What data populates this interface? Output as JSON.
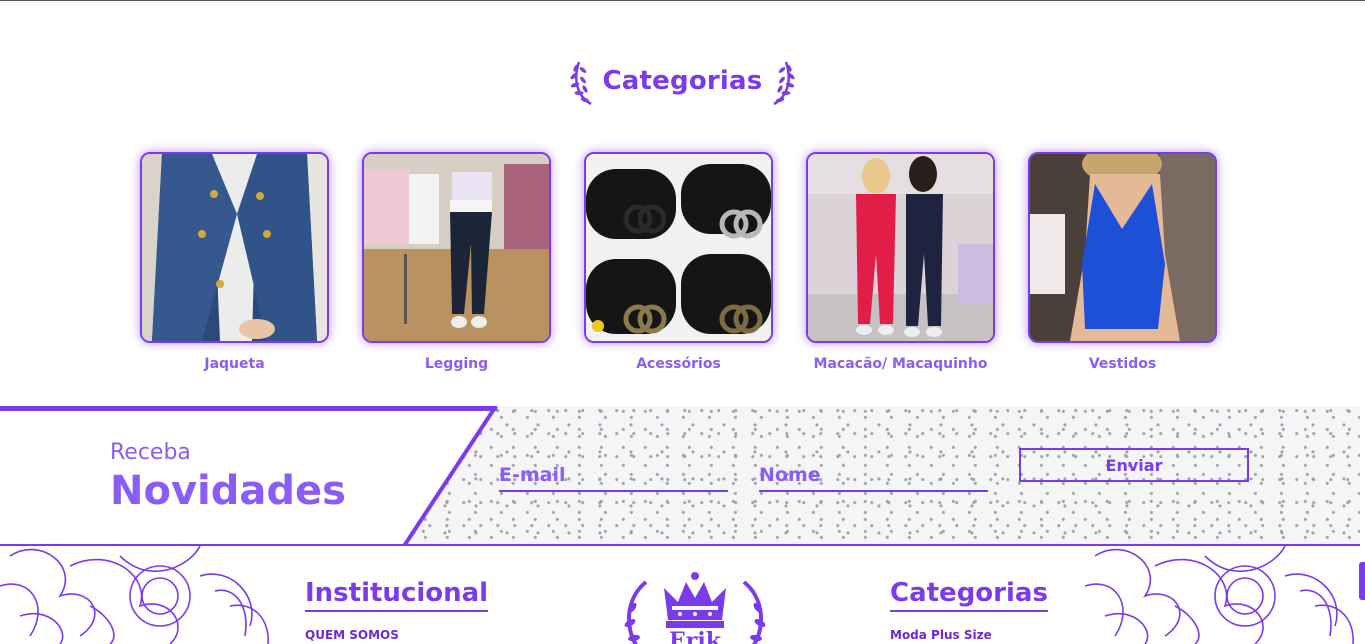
{
  "categories_section": {
    "title": "Categorias",
    "items": [
      {
        "label": "Jaqueta"
      },
      {
        "label": "Legging"
      },
      {
        "label": "Acessórios"
      },
      {
        "label": "Macacão/ Macaquinho"
      },
      {
        "label": "Vestidos"
      }
    ]
  },
  "newsletter": {
    "pre_title": "Receba",
    "title": "Novidades",
    "email_placeholder": "E-mail",
    "name_placeholder": "Nome",
    "submit_label": "Enviar"
  },
  "footer": {
    "institutional_title": "Institucional",
    "institutional_link": "QUEM SOMOS",
    "categories_title": "Categorias",
    "categories_link": "Moda Plus Size",
    "logo_text": "Erik"
  },
  "colors": {
    "accent": "#7c3aed",
    "accent_light": "#8b5cf6"
  }
}
